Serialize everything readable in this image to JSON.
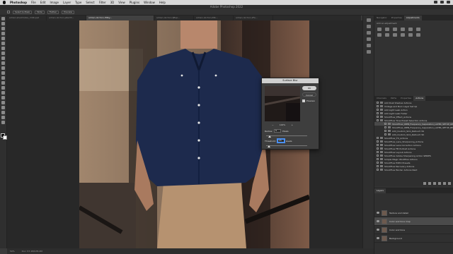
{
  "menubar": {
    "app_name": "Photoshop",
    "items": [
      "File",
      "Edit",
      "Image",
      "Layer",
      "Type",
      "Select",
      "Filter",
      "3D",
      "View",
      "Plugins",
      "Window",
      "Help"
    ]
  },
  "window": {
    "title": "Adobe Photoshop 2022"
  },
  "options_bar": {
    "chips": [
      "Select & Mask",
      "Wide",
      "Flatten",
      "Preview"
    ]
  },
  "document_tabs": [
    "adrien-sherkhobia_Vr96.psd",
    "adrien-olichon-p6w33...",
    "adrien-olichon-r8tby...",
    "adrien-olichon-fJBvp...",
    "adrien-olichon-X8n...",
    "adrien-olichon-2Fe..."
  ],
  "panels": {
    "top_tabs": [
      "Navigator",
      "Properties",
      "Adjustments"
    ],
    "adjustments_label": "Add an adjustment",
    "action_tabs": [
      "Channels",
      "Paths",
      "Properties",
      "Actions"
    ],
    "actions": [
      {
        "label": "Add Dust Shadow Actions",
        "sel": false,
        "sub": false
      },
      {
        "label": "Vintage and Burn Layer Set Up",
        "sel": false,
        "sub": false
      },
      {
        "label": "Add Light Leak Action",
        "sel": false,
        "sub": false
      },
      {
        "label": "Add Light Leak Folder",
        "sel": false,
        "sub": false
      },
      {
        "label": "ShootFlow_Effect_Actions",
        "sel": false,
        "sub": false
      },
      {
        "label": "ShootFlow Tone Preset Selection Actions",
        "sel": false,
        "sub": false
      },
      {
        "label": "ShootFlow_WEB_Frequency_Separation_LAYER_SETUP_RESTO",
        "sel": true,
        "sub": true
      },
      {
        "label": "ShootFlow_WEB_Frequency_Separation_LAYER_SETUP_BW",
        "sel": false,
        "sub": true
      },
      {
        "label": "Add_Custom_Skin_Retouch SS",
        "sel": false,
        "sub": true
      },
      {
        "label": "Add_Custom_Skin_Retouch SK",
        "sel": false,
        "sub": true
      },
      {
        "label": "ShootFlow_FX_Actions",
        "sel": false,
        "sub": false
      },
      {
        "label": "ShootFlow_Lens_Sharpening_Actions",
        "sel": false,
        "sub": false
      },
      {
        "label": "ShootFlow Lens Correction Actions",
        "sel": false,
        "sub": false
      },
      {
        "label": "ShootFlow FB Portrait Actions",
        "sel": false,
        "sub": false
      },
      {
        "label": "ShootFlow Layout Actions",
        "sel": false,
        "sub": false
      },
      {
        "label": "ShootFlow Adobe Sharpening Action SERIES",
        "sel": false,
        "sub": false
      },
      {
        "label": "Simple Magic Workflow Actions",
        "sel": false,
        "sub": false
      },
      {
        "label": "ShootFlow EXPO Presets",
        "sel": false,
        "sub": false
      },
      {
        "label": "ShootFlow Recovery Actions",
        "sel": false,
        "sub": false
      },
      {
        "label": "ShootFlow Border Actions Next",
        "sel": false,
        "sub": false
      }
    ],
    "layers_title": "Layers",
    "layers": [
      {
        "name": "Texture and detail",
        "sel": false
      },
      {
        "name": "Color and tone map",
        "sel": true
      },
      {
        "name": "Color and tone",
        "sel": false
      },
      {
        "name": "Background",
        "sel": false
      }
    ]
  },
  "status": {
    "zoom": "50%",
    "doc": "Doc: 57.1M/135.2M"
  },
  "dialog": {
    "title": "Surface Blur",
    "ok_label": "OK",
    "cancel_label": "Cancel",
    "preview_label": "Preview",
    "zoom_value": "100%",
    "zoom_out": "−",
    "zoom_in": "+",
    "radius_label": "Radius:",
    "radius_value": "5",
    "radius_unit": "Pixels",
    "threshold_label": "Threshold:",
    "threshold_value": "15",
    "threshold_unit": "levels"
  }
}
